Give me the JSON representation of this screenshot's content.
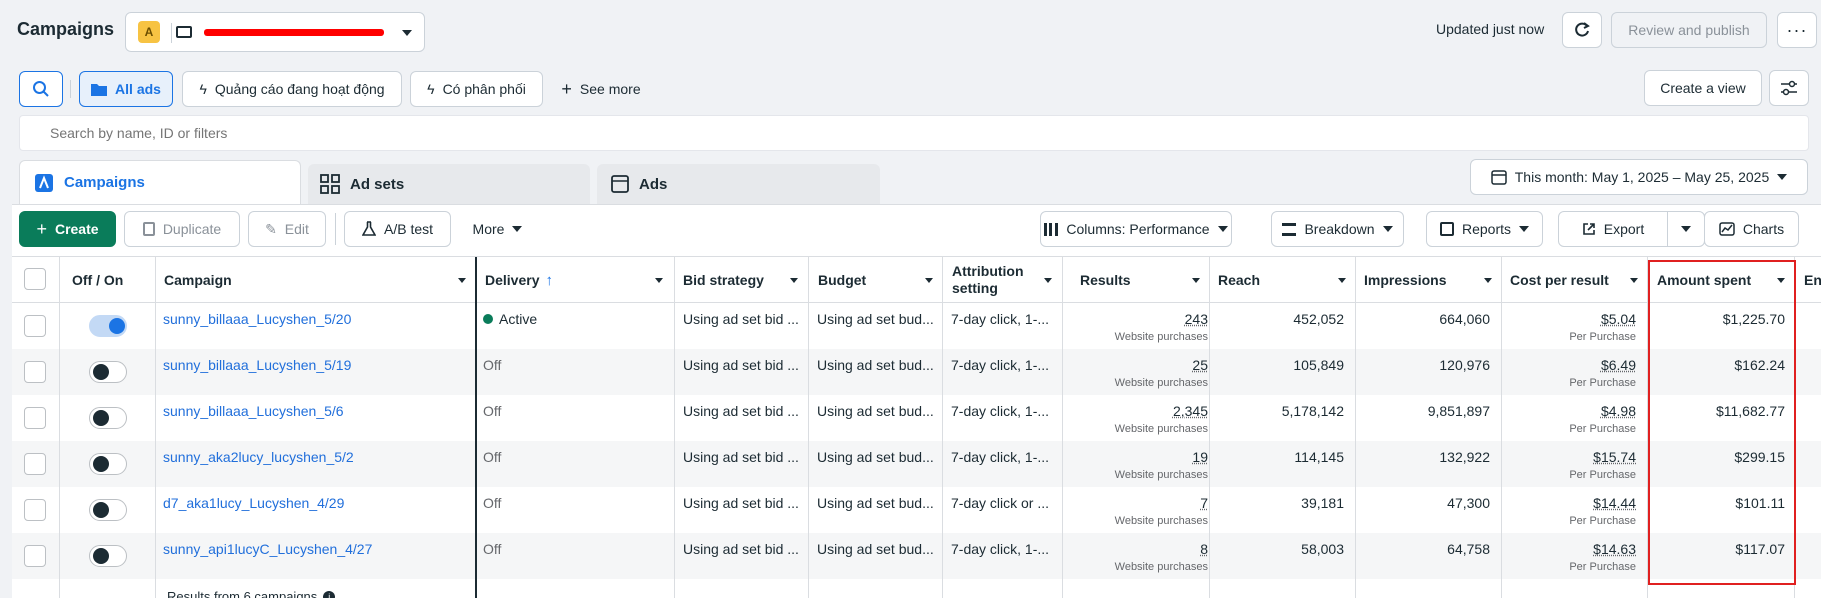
{
  "header": {
    "title": "Campaigns",
    "account_badge": "A",
    "updated_text": "Updated just now",
    "review_publish": "Review and publish",
    "more_icon": "ellipsis-icon"
  },
  "filters": {
    "all_ads": "All ads",
    "active_ads": "Quảng cáo đang hoạt động",
    "delivering": "Có phân phối",
    "see_more": "See more",
    "create_view": "Create a view",
    "search_placeholder": "Search by name, ID or filters"
  },
  "tabs": {
    "campaigns": "Campaigns",
    "ad_sets": "Ad sets",
    "ads": "Ads",
    "date_range": "This month: May 1, 2025 – May 25, 2025"
  },
  "toolbar": {
    "create": "Create",
    "duplicate": "Duplicate",
    "edit": "Edit",
    "ab_test": "A/B test",
    "more": "More",
    "columns": "Columns: Performance",
    "breakdown": "Breakdown",
    "reports": "Reports",
    "export": "Export",
    "charts": "Charts"
  },
  "table": {
    "headers": {
      "off_on": "Off / On",
      "campaign": "Campaign",
      "delivery": "Delivery",
      "bid_strategy": "Bid strategy",
      "budget": "Budget",
      "attribution_1": "Attribution",
      "attribution_2": "setting",
      "results": "Results",
      "reach": "Reach",
      "impressions": "Impressions",
      "cost_per_result": "Cost per result",
      "amount_spent": "Amount spent",
      "ends": "En"
    },
    "rows": [
      {
        "on": true,
        "name": "sunny_billaaa_Lucyshen_5/20",
        "delivery": "Active",
        "bid": "Using ad set bid ...",
        "budget": "Using ad set bud...",
        "attribution": "7-day click, 1-...",
        "results": "243",
        "results_sub": "Website purchases",
        "reach": "452,052",
        "impressions": "664,060",
        "cpr": "$5.04",
        "cpr_sub": "Per Purchase",
        "spent": "$1,225.70"
      },
      {
        "on": false,
        "name": "sunny_billaaa_Lucyshen_5/19",
        "delivery": "Off",
        "bid": "Using ad set bid ...",
        "budget": "Using ad set bud...",
        "attribution": "7-day click, 1-...",
        "results": "25",
        "results_sub": "Website purchases",
        "reach": "105,849",
        "impressions": "120,976",
        "cpr": "$6.49",
        "cpr_sub": "Per Purchase",
        "spent": "$162.24"
      },
      {
        "on": false,
        "name": "sunny_billaaa_Lucyshen_5/6",
        "delivery": "Off",
        "bid": "Using ad set bid ...",
        "budget": "Using ad set bud...",
        "attribution": "7-day click, 1-...",
        "results": "2,345",
        "results_sub": "Website purchases",
        "reach": "5,178,142",
        "impressions": "9,851,897",
        "cpr": "$4.98",
        "cpr_sub": "Per Purchase",
        "spent": "$11,682.77"
      },
      {
        "on": false,
        "name": "sunny_aka2lucy_lucyshen_5/2",
        "delivery": "Off",
        "bid": "Using ad set bid ...",
        "budget": "Using ad set bud...",
        "attribution": "7-day click, 1-...",
        "results": "19",
        "results_sub": "Website purchases",
        "reach": "114,145",
        "impressions": "132,922",
        "cpr": "$15.74",
        "cpr_sub": "Per Purchase",
        "spent": "$299.15"
      },
      {
        "on": false,
        "name": "d7_aka1lucy_Lucyshen_4/29",
        "delivery": "Off",
        "bid": "Using ad set bid ...",
        "budget": "Using ad set bud...",
        "attribution": "7-day click or ...",
        "results": "7",
        "results_sub": "Website purchases",
        "reach": "39,181",
        "impressions": "47,300",
        "cpr": "$14.44",
        "cpr_sub": "Per Purchase",
        "spent": "$101.11"
      },
      {
        "on": false,
        "name": "sunny_api1lucyC_Lucyshen_4/27",
        "delivery": "Off",
        "bid": "Using ad set bid ...",
        "budget": "Using ad set bud...",
        "attribution": "7-day click, 1-...",
        "results": "8",
        "results_sub": "Website purchases",
        "reach": "58,003",
        "impressions": "64,758",
        "cpr": "$14.63",
        "cpr_sub": "Per Purchase",
        "spent": "$117.07"
      }
    ],
    "footer": "Results from 6 campaigns"
  },
  "colors": {
    "accent": "#1b74e4",
    "create_green": "#0a7c5a",
    "active_dot": "#0a7c5a",
    "highlight_box": "#e02020",
    "redaction": "#ff0000"
  }
}
